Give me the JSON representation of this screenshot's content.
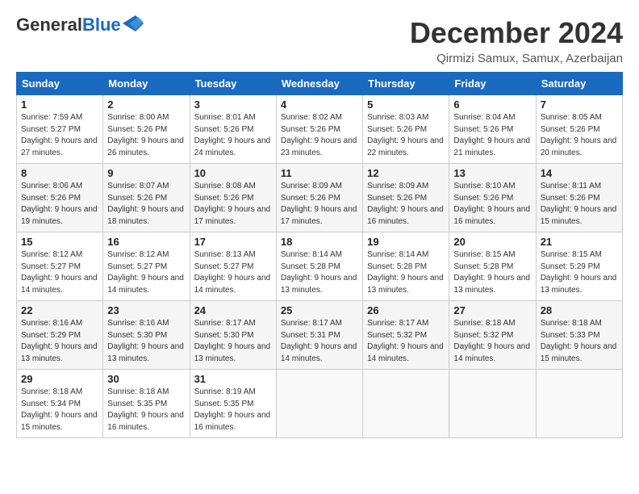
{
  "header": {
    "logo_general": "General",
    "logo_blue": "Blue",
    "month": "December 2024",
    "location": "Qirmizi Samux, Samux, Azerbaijan"
  },
  "weekdays": [
    "Sunday",
    "Monday",
    "Tuesday",
    "Wednesday",
    "Thursday",
    "Friday",
    "Saturday"
  ],
  "weeks": [
    [
      {
        "day": "1",
        "sunrise": "7:59 AM",
        "sunset": "5:27 PM",
        "daylight": "9 hours and 27 minutes."
      },
      {
        "day": "2",
        "sunrise": "8:00 AM",
        "sunset": "5:26 PM",
        "daylight": "9 hours and 26 minutes."
      },
      {
        "day": "3",
        "sunrise": "8:01 AM",
        "sunset": "5:26 PM",
        "daylight": "9 hours and 24 minutes."
      },
      {
        "day": "4",
        "sunrise": "8:02 AM",
        "sunset": "5:26 PM",
        "daylight": "9 hours and 23 minutes."
      },
      {
        "day": "5",
        "sunrise": "8:03 AM",
        "sunset": "5:26 PM",
        "daylight": "9 hours and 22 minutes."
      },
      {
        "day": "6",
        "sunrise": "8:04 AM",
        "sunset": "5:26 PM",
        "daylight": "9 hours and 21 minutes."
      },
      {
        "day": "7",
        "sunrise": "8:05 AM",
        "sunset": "5:26 PM",
        "daylight": "9 hours and 20 minutes."
      }
    ],
    [
      {
        "day": "8",
        "sunrise": "8:06 AM",
        "sunset": "5:26 PM",
        "daylight": "9 hours and 19 minutes."
      },
      {
        "day": "9",
        "sunrise": "8:07 AM",
        "sunset": "5:26 PM",
        "daylight": "9 hours and 18 minutes."
      },
      {
        "day": "10",
        "sunrise": "8:08 AM",
        "sunset": "5:26 PM",
        "daylight": "9 hours and 17 minutes."
      },
      {
        "day": "11",
        "sunrise": "8:09 AM",
        "sunset": "5:26 PM",
        "daylight": "9 hours and 17 minutes."
      },
      {
        "day": "12",
        "sunrise": "8:09 AM",
        "sunset": "5:26 PM",
        "daylight": "9 hours and 16 minutes."
      },
      {
        "day": "13",
        "sunrise": "8:10 AM",
        "sunset": "5:26 PM",
        "daylight": "9 hours and 16 minutes."
      },
      {
        "day": "14",
        "sunrise": "8:11 AM",
        "sunset": "5:26 PM",
        "daylight": "9 hours and 15 minutes."
      }
    ],
    [
      {
        "day": "15",
        "sunrise": "8:12 AM",
        "sunset": "5:27 PM",
        "daylight": "9 hours and 14 minutes."
      },
      {
        "day": "16",
        "sunrise": "8:12 AM",
        "sunset": "5:27 PM",
        "daylight": "9 hours and 14 minutes."
      },
      {
        "day": "17",
        "sunrise": "8:13 AM",
        "sunset": "5:27 PM",
        "daylight": "9 hours and 14 minutes."
      },
      {
        "day": "18",
        "sunrise": "8:14 AM",
        "sunset": "5:28 PM",
        "daylight": "9 hours and 13 minutes."
      },
      {
        "day": "19",
        "sunrise": "8:14 AM",
        "sunset": "5:28 PM",
        "daylight": "9 hours and 13 minutes."
      },
      {
        "day": "20",
        "sunrise": "8:15 AM",
        "sunset": "5:28 PM",
        "daylight": "9 hours and 13 minutes."
      },
      {
        "day": "21",
        "sunrise": "8:15 AM",
        "sunset": "5:29 PM",
        "daylight": "9 hours and 13 minutes."
      }
    ],
    [
      {
        "day": "22",
        "sunrise": "8:16 AM",
        "sunset": "5:29 PM",
        "daylight": "9 hours and 13 minutes."
      },
      {
        "day": "23",
        "sunrise": "8:16 AM",
        "sunset": "5:30 PM",
        "daylight": "9 hours and 13 minutes."
      },
      {
        "day": "24",
        "sunrise": "8:17 AM",
        "sunset": "5:30 PM",
        "daylight": "9 hours and 13 minutes."
      },
      {
        "day": "25",
        "sunrise": "8:17 AM",
        "sunset": "5:31 PM",
        "daylight": "9 hours and 14 minutes."
      },
      {
        "day": "26",
        "sunrise": "8:17 AM",
        "sunset": "5:32 PM",
        "daylight": "9 hours and 14 minutes."
      },
      {
        "day": "27",
        "sunrise": "8:18 AM",
        "sunset": "5:32 PM",
        "daylight": "9 hours and 14 minutes."
      },
      {
        "day": "28",
        "sunrise": "8:18 AM",
        "sunset": "5:33 PM",
        "daylight": "9 hours and 15 minutes."
      }
    ],
    [
      {
        "day": "29",
        "sunrise": "8:18 AM",
        "sunset": "5:34 PM",
        "daylight": "9 hours and 15 minutes."
      },
      {
        "day": "30",
        "sunrise": "8:18 AM",
        "sunset": "5:35 PM",
        "daylight": "9 hours and 16 minutes."
      },
      {
        "day": "31",
        "sunrise": "8:19 AM",
        "sunset": "5:35 PM",
        "daylight": "9 hours and 16 minutes."
      },
      null,
      null,
      null,
      null
    ]
  ]
}
